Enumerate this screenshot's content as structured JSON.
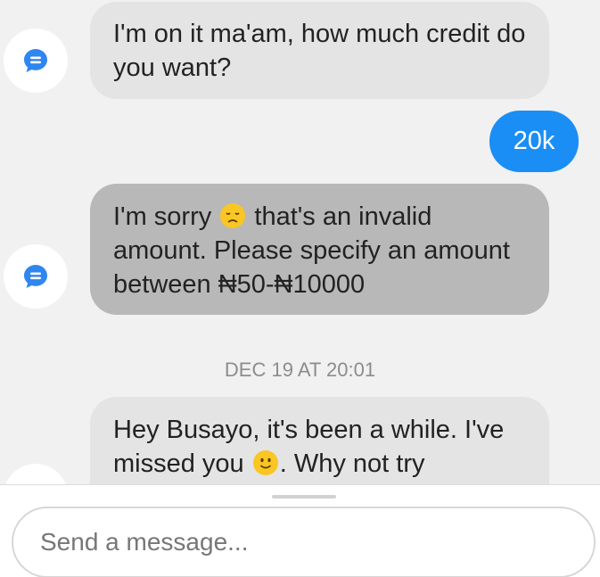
{
  "messages": [
    {
      "from": "bot",
      "text": "I'm on it ma'am, how much credit do you want?"
    },
    {
      "from": "user",
      "text": "20k"
    },
    {
      "from": "bot",
      "text_before": "I'm sorry",
      "emoji_1": "disappointed-face",
      "text_after": "that's an invalid amount. Please specify an amount between ₦50-₦10000"
    },
    {
      "from": "bot",
      "text_before": "Hey Busayo, it's been a while. I've missed you",
      "emoji_2": "slightly-smiling-face",
      "text_after": ". Why not try"
    }
  ],
  "timestamp": "DEC 19 AT 20:01",
  "composer": {
    "placeholder": "Send a message..."
  },
  "colors": {
    "outgoing": "#1a8ef5",
    "incoming": "#e4e4e4",
    "incoming_highlight": "#b8b8b8",
    "bot_icon": "#2f86f0"
  }
}
